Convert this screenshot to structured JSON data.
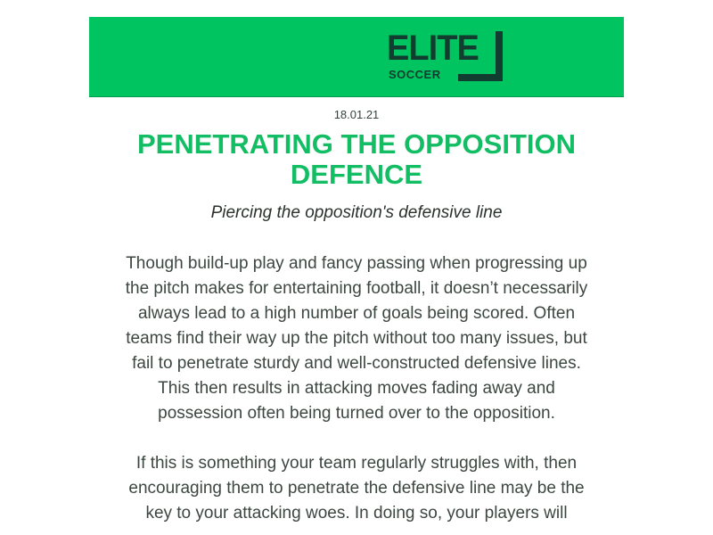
{
  "header": {
    "logo": {
      "wordmark": "ELITE",
      "subtitle": "SOCCER"
    }
  },
  "article": {
    "date": "18.01.21",
    "title": "PENETRATING THE OPPOSITION DEFENCE",
    "subtitle": "Piercing the opposition's defensive line",
    "paragraphs": [
      "Though build-up play and fancy passing when progressing up the pitch makes for entertaining football, it doesn’t necessarily always lead to a high number of goals being scored. Often teams find their way up the pitch without too many issues, but fail to penetrate sturdy and well-constructed defensive lines. This then results in attacking moves fading away and possession often being turned over to the opposition.",
      "If this is something your team regularly struggles with, then encouraging them to penetrate the defensive line may be the key to your attacking woes. In doing so, your players will"
    ]
  },
  "colors": {
    "header_background": "#00c45f",
    "logo_dark": "#123c2f",
    "title_green": "#13bd63",
    "body_text": "#3d4741"
  }
}
